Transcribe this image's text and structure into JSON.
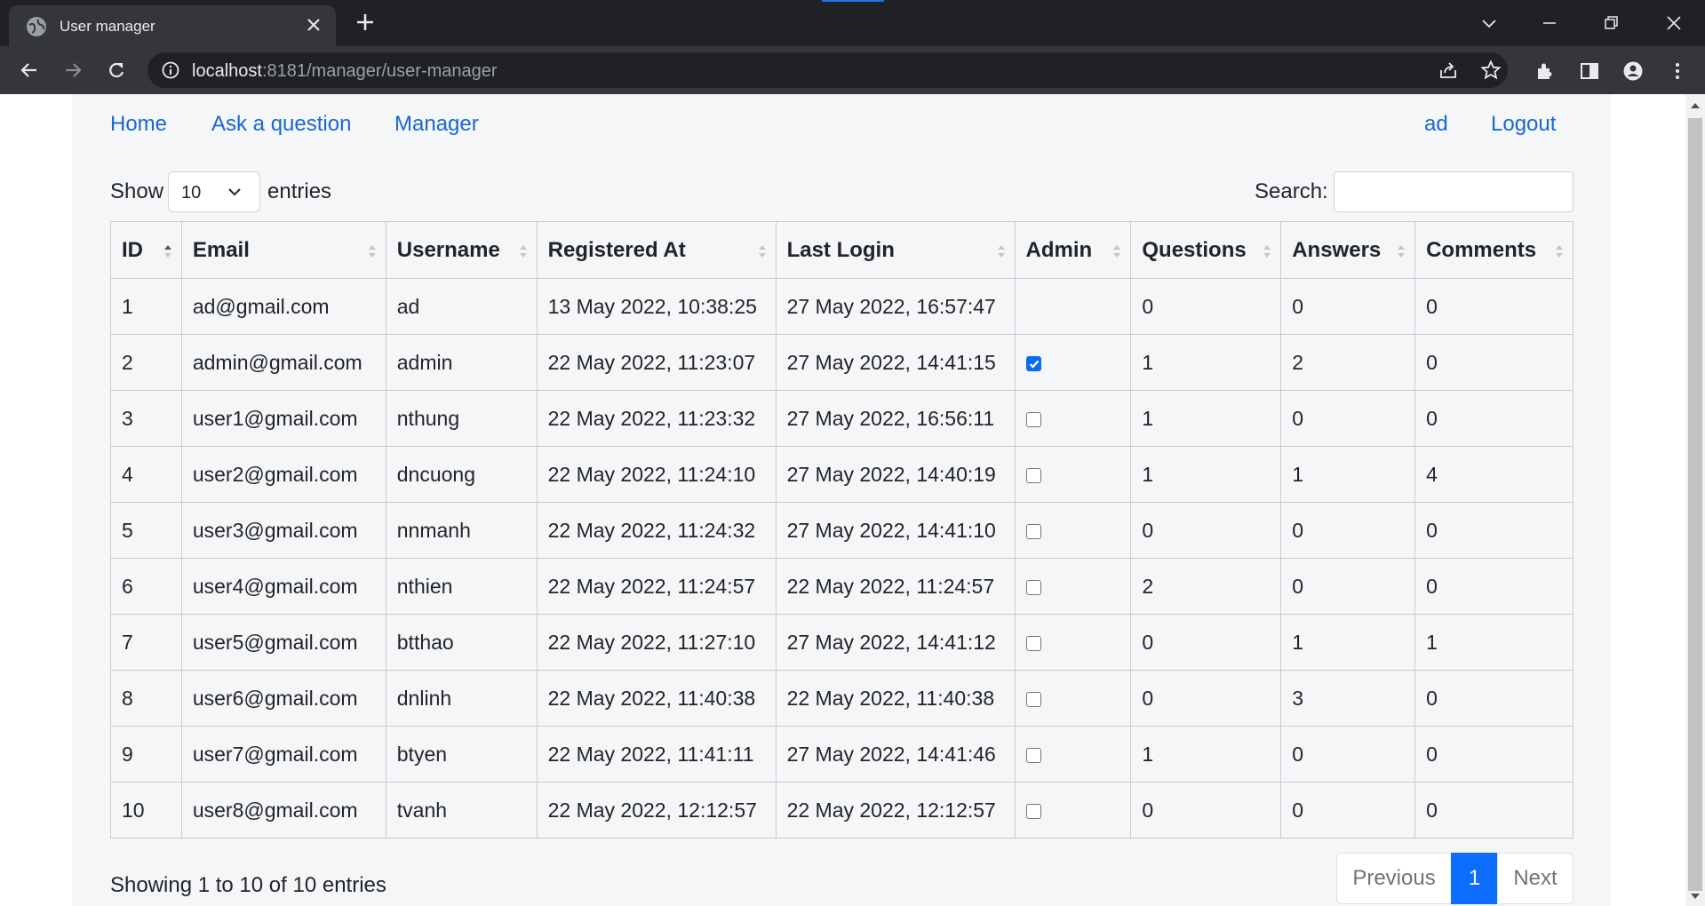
{
  "browser": {
    "tab_title": "User manager",
    "url_host": "localhost",
    "url_path": ":8181/manager/user-manager"
  },
  "nav": {
    "home": "Home",
    "ask": "Ask a question",
    "manager": "Manager",
    "user": "ad",
    "logout": "Logout"
  },
  "controls": {
    "show_label": "Show",
    "page_size": "10",
    "entries_label": "entries",
    "search_label": "Search:",
    "search_value": ""
  },
  "table": {
    "columns": [
      "ID",
      "Email",
      "Username",
      "Registered At",
      "Last Login",
      "Admin",
      "Questions",
      "Answers",
      "Comments"
    ],
    "rows": [
      {
        "id": "1",
        "email": "ad@gmail.com",
        "username": "ad",
        "registered": "13 May 2022, 10:38:25",
        "last_login": "27 May 2022, 16:57:47",
        "admin": null,
        "questions": "0",
        "answers": "0",
        "comments": "0"
      },
      {
        "id": "2",
        "email": "admin@gmail.com",
        "username": "admin",
        "registered": "22 May 2022, 11:23:07",
        "last_login": "27 May 2022, 14:41:15",
        "admin": true,
        "questions": "1",
        "answers": "2",
        "comments": "0"
      },
      {
        "id": "3",
        "email": "user1@gmail.com",
        "username": "nthung",
        "registered": "22 May 2022, 11:23:32",
        "last_login": "27 May 2022, 16:56:11",
        "admin": false,
        "questions": "1",
        "answers": "0",
        "comments": "0"
      },
      {
        "id": "4",
        "email": "user2@gmail.com",
        "username": "dncuong",
        "registered": "22 May 2022, 11:24:10",
        "last_login": "27 May 2022, 14:40:19",
        "admin": false,
        "questions": "1",
        "answers": "1",
        "comments": "4"
      },
      {
        "id": "5",
        "email": "user3@gmail.com",
        "username": "nnmanh",
        "registered": "22 May 2022, 11:24:32",
        "last_login": "27 May 2022, 14:41:10",
        "admin": false,
        "questions": "0",
        "answers": "0",
        "comments": "0"
      },
      {
        "id": "6",
        "email": "user4@gmail.com",
        "username": "nthien",
        "registered": "22 May 2022, 11:24:57",
        "last_login": "22 May 2022, 11:24:57",
        "admin": false,
        "questions": "2",
        "answers": "0",
        "comments": "0"
      },
      {
        "id": "7",
        "email": "user5@gmail.com",
        "username": "btthao",
        "registered": "22 May 2022, 11:27:10",
        "last_login": "27 May 2022, 14:41:12",
        "admin": false,
        "questions": "0",
        "answers": "1",
        "comments": "1"
      },
      {
        "id": "8",
        "email": "user6@gmail.com",
        "username": "dnlinh",
        "registered": "22 May 2022, 11:40:38",
        "last_login": "22 May 2022, 11:40:38",
        "admin": false,
        "questions": "0",
        "answers": "3",
        "comments": "0"
      },
      {
        "id": "9",
        "email": "user7@gmail.com",
        "username": "btyen",
        "registered": "22 May 2022, 11:41:11",
        "last_login": "27 May 2022, 14:41:46",
        "admin": false,
        "questions": "1",
        "answers": "0",
        "comments": "0"
      },
      {
        "id": "10",
        "email": "user8@gmail.com",
        "username": "tvanh",
        "registered": "22 May 2022, 12:12:57",
        "last_login": "22 May 2022, 12:12:57",
        "admin": false,
        "questions": "0",
        "answers": "0",
        "comments": "0"
      }
    ]
  },
  "footer": {
    "info": "Showing 1 to 10 of 10 entries",
    "previous": "Previous",
    "current_page": "1",
    "next": "Next"
  },
  "colors": {
    "link": "#1967d2",
    "active_page": "#0d6efd",
    "checkbox_checked": "#0b6cf0"
  },
  "icons": [
    "globe-icon",
    "close-icon",
    "plus-icon",
    "back-icon",
    "forward-icon",
    "reload-icon",
    "info-icon",
    "share-icon",
    "star-icon",
    "extensions-icon",
    "side-panel-icon",
    "profile-icon",
    "menu-icon",
    "chevron-down-icon",
    "sort-icon"
  ]
}
